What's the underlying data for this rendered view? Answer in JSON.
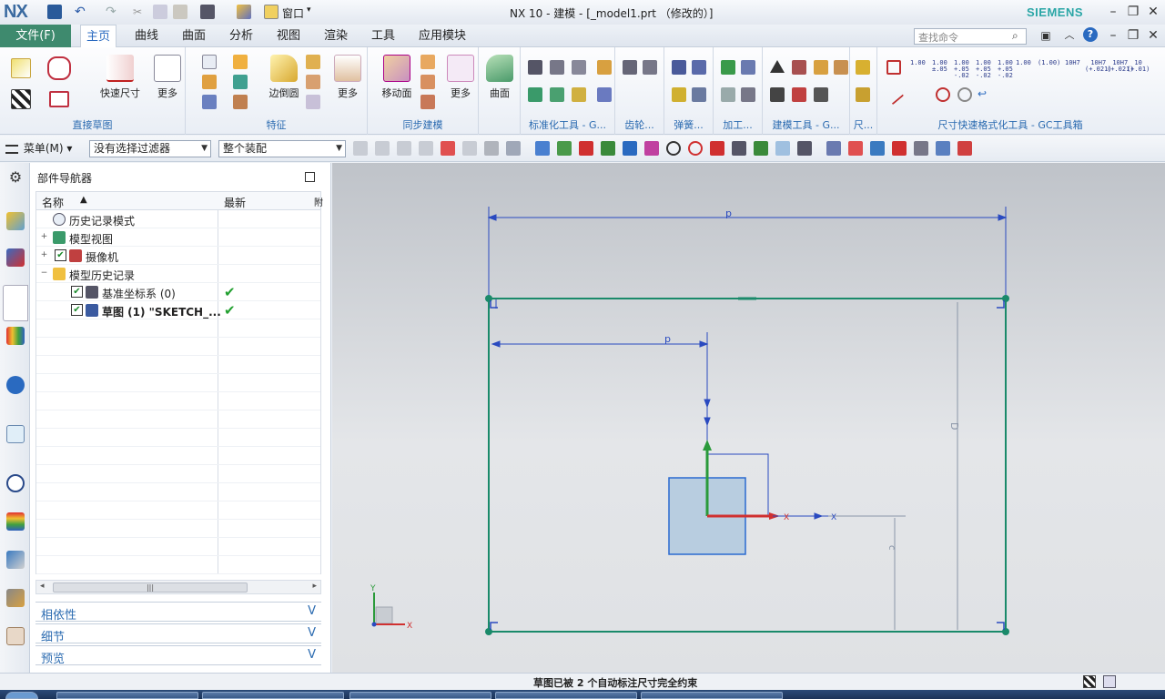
{
  "app": {
    "logo": "NX",
    "window_title": "NX 10 - 建模 - [_model1.prt （修改的）]",
    "brand": "SIEMENS",
    "window_menu": "窗口"
  },
  "menubar": {
    "file_tab": "文件(F)",
    "tabs": [
      "主页",
      "曲线",
      "曲面",
      "分析",
      "视图",
      "渲染",
      "工具",
      "应用模块"
    ],
    "active_tab": "主页",
    "search_placeholder": "查找命令"
  },
  "ribbon": {
    "groups": [
      {
        "label": "直接草图"
      },
      {
        "label": "特征"
      },
      {
        "label": "同步建模"
      },
      {
        "label": "标准化工具 - G..."
      },
      {
        "label": "齿轮..."
      },
      {
        "label": "弹簧..."
      },
      {
        "label": "加工..."
      },
      {
        "label": "建模工具 - G..."
      },
      {
        "label": "尺..."
      },
      {
        "label": "尺寸快速格式化工具 - GC工具箱"
      }
    ],
    "buttons": {
      "quick_dim": "快速尺寸",
      "more1": "更多",
      "edge_blend": "边倒圆",
      "more2": "更多",
      "move_face": "移动面",
      "more3": "更多",
      "surface": "曲面"
    },
    "dim_formats": [
      "1.00",
      "1.00\n±.05",
      "1.00\n+.05\n-.02",
      "1.00\n+.05\n-.02",
      "1.00\n+.05\n-.02",
      "1.00",
      "(1.00)",
      "10H7",
      "10H7\n(+.021)",
      "10H7\n(+.021)",
      "10\n(+.01)"
    ]
  },
  "toolbar2": {
    "menu": "菜单(M)",
    "filter": "没有选择过滤器",
    "assembly": "整个装配"
  },
  "navigator": {
    "title": "部件导航器",
    "columns": [
      "名称",
      "最新",
      "附"
    ],
    "rows": [
      {
        "label": "历史记录模式",
        "expand": "",
        "icon": "history-icon",
        "check": false,
        "latest": false,
        "bold": false
      },
      {
        "label": "模型视图",
        "expand": "+",
        "icon": "model-views-icon",
        "check": false,
        "latest": false,
        "bold": false
      },
      {
        "label": "摄像机",
        "expand": "+",
        "icon": "camera-icon",
        "check": true,
        "latest": false,
        "bold": false
      },
      {
        "label": "模型历史记录",
        "expand": "−",
        "icon": "folder-icon",
        "check": false,
        "latest": false,
        "bold": false
      },
      {
        "label": "基准坐标系 (0)",
        "expand": "",
        "icon": "datum-csys-icon",
        "check": true,
        "latest": true,
        "bold": false
      },
      {
        "label": "草图 (1) \"SKETCH_...",
        "expand": "",
        "icon": "sketch-icon",
        "check": true,
        "latest": true,
        "bold": true
      }
    ],
    "accordion": [
      "相依性",
      "细节",
      "预览"
    ]
  },
  "graphics": {
    "dim_labels": [
      "p",
      "p",
      "D",
      "c"
    ]
  },
  "status": {
    "message": "草图已被 2 个自动标注尺寸完全约束"
  },
  "colors": {
    "accent_blue": "#2a6ab0",
    "file_tab": "#3e8a6e",
    "sketch_green": "#1a8a6a",
    "dim_blue": "#2a4ac0",
    "block_fill": "#b8cde0"
  }
}
